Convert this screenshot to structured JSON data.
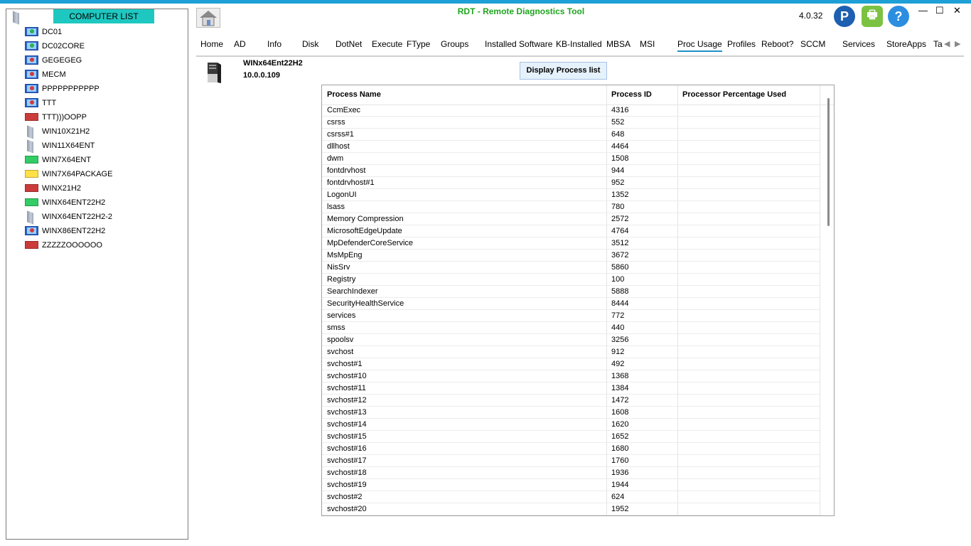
{
  "app": {
    "title": "RDT - Remote Diagnostics Tool",
    "version": "4.0.32",
    "title_color": "#1ea51e",
    "topbar_color": "#1ea0d6",
    "window_controls": [
      "—",
      "☐",
      "✕"
    ]
  },
  "toolbar": {
    "paypal_label": "P",
    "printer_label": "🖶",
    "help_label": "?"
  },
  "sidebar": {
    "header": "COMPUTER LIST",
    "header_bg": "#1ec8c0",
    "computers": [
      {
        "name": "DC01",
        "icon": "monitor",
        "dot": "#2bb34a"
      },
      {
        "name": "DC02CORE",
        "icon": "monitor",
        "dot": "#2bb34a"
      },
      {
        "name": "GEGEGEG",
        "icon": "monitor",
        "dot": "#d23b3b"
      },
      {
        "name": "MECM",
        "icon": "monitor",
        "dot": "#d23b3b"
      },
      {
        "name": "PPPPPPPPPPP",
        "icon": "monitor",
        "dot": "#d23b3b"
      },
      {
        "name": "TTT",
        "icon": "monitor",
        "dot": "#d23b3b"
      },
      {
        "name": "TTT)))OOPP",
        "icon": "bar",
        "color": "#cc3b3b"
      },
      {
        "name": "WIN10X21H2",
        "icon": "tower"
      },
      {
        "name": "WIN11X64ENT",
        "icon": "tower"
      },
      {
        "name": "WIN7X64ENT",
        "icon": "bar",
        "color": "#33cc66"
      },
      {
        "name": "WIN7X64PACKAGE",
        "icon": "bar",
        "color": "#ffe045"
      },
      {
        "name": "WINX21H2",
        "icon": "bar",
        "color": "#cc3b3b"
      },
      {
        "name": "WINX64ENT22H2",
        "icon": "bar",
        "color": "#33cc66"
      },
      {
        "name": "WINX64ENT22H2-2",
        "icon": "tower"
      },
      {
        "name": "WINX86ENT22H2",
        "icon": "monitor",
        "dot": "#d23b3b"
      },
      {
        "name": "ZZZZZOOOOOO",
        "icon": "bar",
        "color": "#cc3b3b"
      }
    ]
  },
  "tabs": [
    {
      "label": "Home"
    },
    {
      "label": "AD"
    },
    {
      "label": "Info"
    },
    {
      "label": "Disk"
    },
    {
      "label": "DotNet"
    },
    {
      "label": "Execute"
    },
    {
      "label": "FType"
    },
    {
      "label": "Groups"
    },
    {
      "label": "Installed Software"
    },
    {
      "label": "KB-Installed"
    },
    {
      "label": "MBSA"
    },
    {
      "label": "MSI"
    },
    {
      "label": "Proc Usage",
      "active": true
    },
    {
      "label": "Profiles"
    },
    {
      "label": "Reboot?"
    },
    {
      "label": "SCCM"
    },
    {
      "label": "Services"
    },
    {
      "label": "StoreApps"
    },
    {
      "label": "Ta"
    }
  ],
  "host": {
    "name": "WINx64Ent22H2",
    "ip": "10.0.0.109"
  },
  "action": {
    "display_label": "Display Process list"
  },
  "grid": {
    "columns": [
      "Process Name",
      "Process ID",
      "Processor Percentage Used"
    ],
    "rows": [
      [
        "CcmExec",
        "4316",
        ""
      ],
      [
        "csrss",
        "552",
        ""
      ],
      [
        "csrss#1",
        "648",
        ""
      ],
      [
        "dllhost",
        "4464",
        ""
      ],
      [
        "dwm",
        "1508",
        ""
      ],
      [
        "fontdrvhost",
        "944",
        ""
      ],
      [
        "fontdrvhost#1",
        "952",
        ""
      ],
      [
        "LogonUI",
        "1352",
        ""
      ],
      [
        "lsass",
        "780",
        ""
      ],
      [
        "Memory Compression",
        "2572",
        ""
      ],
      [
        "MicrosoftEdgeUpdate",
        "4764",
        ""
      ],
      [
        "MpDefenderCoreService",
        "3512",
        ""
      ],
      [
        "MsMpEng",
        "3672",
        ""
      ],
      [
        "NisSrv",
        "5860",
        ""
      ],
      [
        "Registry",
        "100",
        ""
      ],
      [
        "SearchIndexer",
        "5888",
        ""
      ],
      [
        "SecurityHealthService",
        "8444",
        ""
      ],
      [
        "services",
        "772",
        ""
      ],
      [
        "smss",
        "440",
        ""
      ],
      [
        "spoolsv",
        "3256",
        ""
      ],
      [
        "svchost",
        "912",
        ""
      ],
      [
        "svchost#1",
        "492",
        ""
      ],
      [
        "svchost#10",
        "1368",
        ""
      ],
      [
        "svchost#11",
        "1384",
        ""
      ],
      [
        "svchost#12",
        "1472",
        ""
      ],
      [
        "svchost#13",
        "1608",
        ""
      ],
      [
        "svchost#14",
        "1620",
        ""
      ],
      [
        "svchost#15",
        "1652",
        ""
      ],
      [
        "svchost#16",
        "1680",
        ""
      ],
      [
        "svchost#17",
        "1760",
        ""
      ],
      [
        "svchost#18",
        "1936",
        ""
      ],
      [
        "svchost#19",
        "1944",
        ""
      ],
      [
        "svchost#2",
        "624",
        ""
      ],
      [
        "svchost#20",
        "1952",
        ""
      ]
    ]
  }
}
